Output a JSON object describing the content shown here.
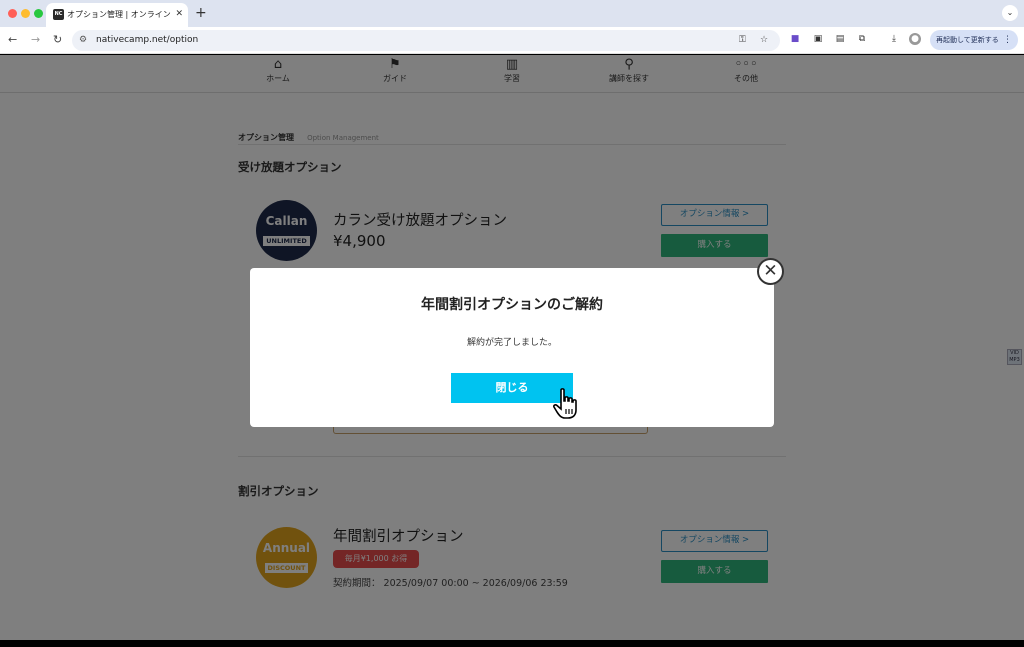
{
  "browser": {
    "tab_title": "オプション管理 | オンライン英会話",
    "tab_favicon": "NC",
    "tab_close": "✕",
    "new_tab": "+",
    "tab_menu": "⌄",
    "url": "nativecamp.net/option",
    "relaunch_label": "再起動して更新する",
    "relaunch_dots": "⋮"
  },
  "nav": {
    "items": [
      {
        "label": "ホーム",
        "icon": "home-icon"
      },
      {
        "label": "ガイド",
        "icon": "signpost-icon"
      },
      {
        "label": "学習",
        "icon": "book-icon"
      },
      {
        "label": "講師を探す",
        "icon": "search-icon"
      },
      {
        "label": "その他",
        "icon": "more-icon"
      }
    ]
  },
  "card": {
    "title": "オプション管理",
    "subtitle": "Option Management"
  },
  "unlimited": {
    "section_title": "受け放題オプション",
    "badge_main": "Callan",
    "badge_sub": "UNLIMITED",
    "name": "カラン受け放題オプション",
    "price": "¥4,900",
    "info_label": "オプション情報 >",
    "buy_label": "購入する"
  },
  "discount": {
    "section_title": "割引オプション",
    "badge_main": "Annual",
    "badge_sub": "DISCOUNT",
    "name": "年間割引オプション",
    "tag": "毎月¥1,000 お得",
    "period": "契約期間： 2025/09/07 00:00 ~ 2026/09/06 23:59",
    "info_label": "オプション情報 >",
    "buy_label": "購入する"
  },
  "side_tab": "VID MP3",
  "modal": {
    "title": "年間割引オプションのご解約",
    "message": "解約が完了しました。",
    "button": "閉じる",
    "close_glyph": "✕"
  },
  "colors": {
    "accent": "#00c3f0",
    "buy": "#2fb67c",
    "info_border": "#2a8fc4",
    "callan_badge": "#1e2a4a",
    "annual_badge": "#e3a51c",
    "tag_red": "#e84c4c"
  }
}
